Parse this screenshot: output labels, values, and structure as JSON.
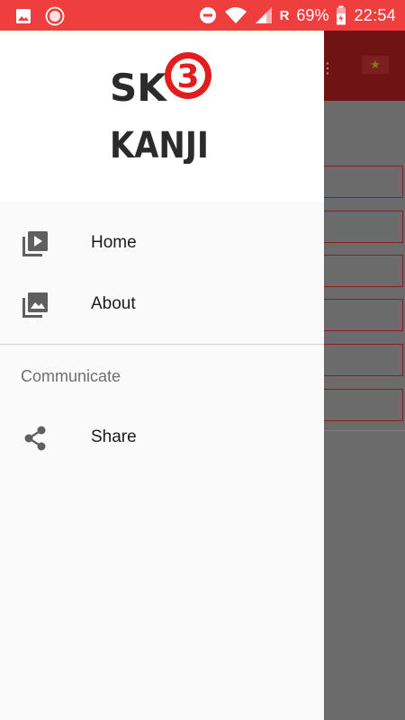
{
  "status_bar": {
    "battery_percent": "69%",
    "network_label": "R",
    "time": "22:54",
    "icons": [
      "image-icon",
      "record-icon",
      "dnd-icon",
      "wifi-icon",
      "signal-icon",
      "battery-icon"
    ]
  },
  "logo": {
    "line1": "SK",
    "number": "3",
    "line2": "KANJI"
  },
  "drawer": {
    "items": [
      {
        "label": "Home",
        "icon": "video-library-icon"
      },
      {
        "label": "About",
        "icon": "photo-library-icon"
      }
    ],
    "section_title": "Communicate",
    "section_items": [
      {
        "label": "Share",
        "icon": "share-icon"
      }
    ]
  },
  "colors": {
    "status_bar": "#ef3e3e",
    "logo_red": "#e21d1d",
    "logo_dark": "#2b2b2b",
    "drawer_bg": "#fafafa",
    "scrim": "#6b6b6b"
  }
}
